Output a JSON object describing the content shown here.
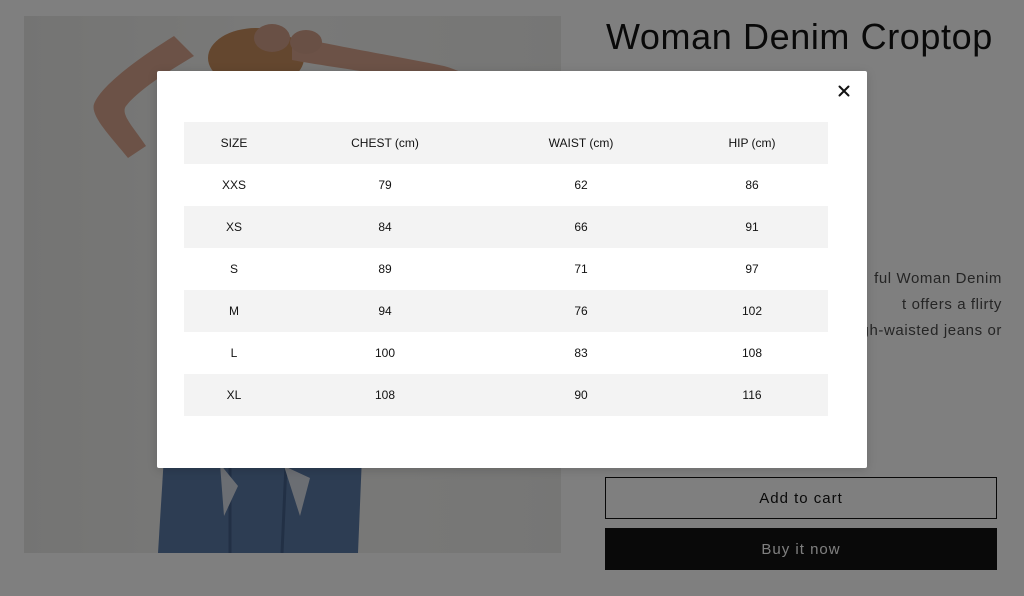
{
  "product": {
    "title": "Woman Denim Croptop",
    "description_visible": "ful Woman Denim\nt offers a flirty\ngh-waisted jeans or",
    "add_to_cart_label": "Add to cart",
    "buy_now_label": "Buy it now"
  },
  "size_chart": {
    "close_icon": "close-icon",
    "headers": [
      "SIZE",
      "CHEST (cm)",
      "WAIST (cm)",
      "HIP (cm)"
    ],
    "rows": [
      [
        "XXS",
        "79",
        "62",
        "86"
      ],
      [
        "XS",
        "84",
        "66",
        "91"
      ],
      [
        "S",
        "89",
        "71",
        "97"
      ],
      [
        "M",
        "94",
        "76",
        "102"
      ],
      [
        "L",
        "100",
        "83",
        "108"
      ],
      [
        "XL",
        "108",
        "90",
        "116"
      ]
    ]
  },
  "colors": {
    "overlay": "#000000",
    "button_dark": "#121212",
    "table_stripe": "#f3f3f3",
    "text_primary": "#121212"
  }
}
